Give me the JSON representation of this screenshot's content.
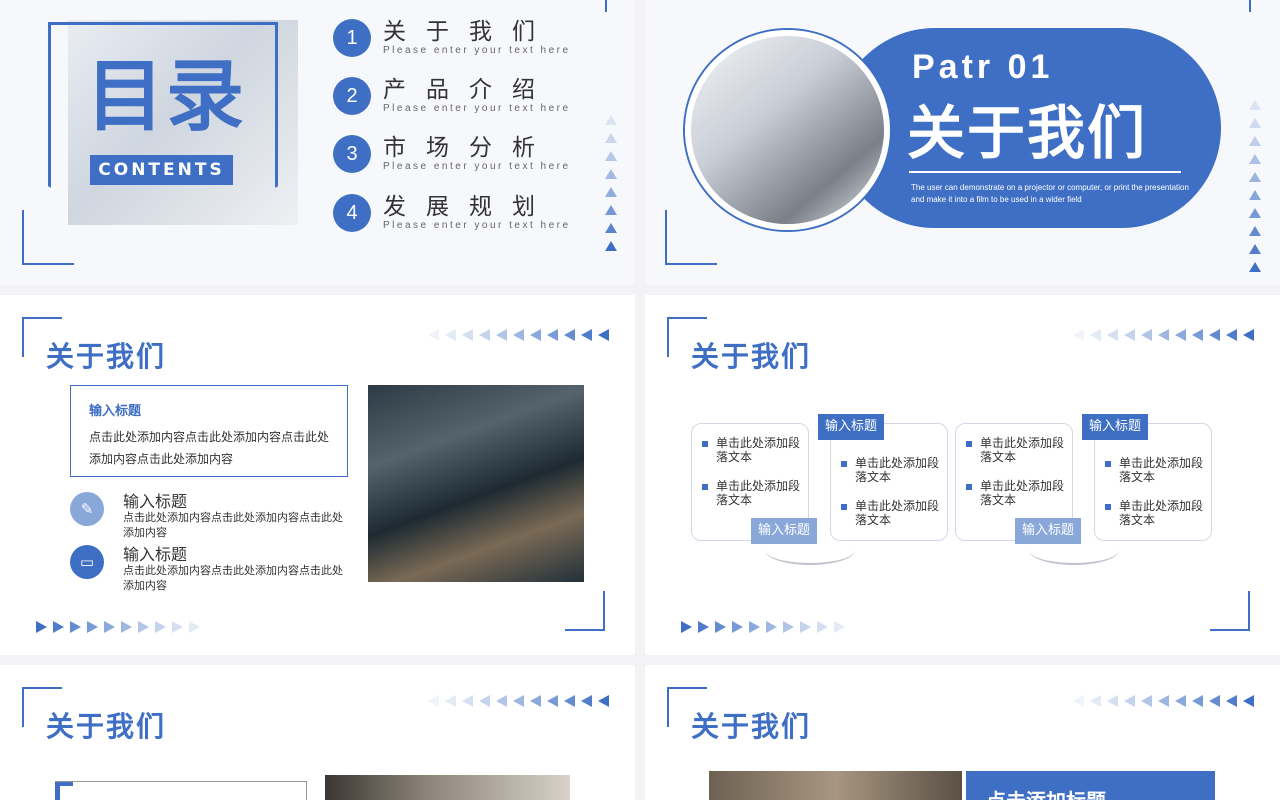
{
  "slide1": {
    "title": "目录",
    "subtitle": "CONTENTS",
    "items": [
      {
        "num": "1",
        "title": "关于我们",
        "sub": "Please enter your text here"
      },
      {
        "num": "2",
        "title": "产品介绍",
        "sub": "Please enter your text here"
      },
      {
        "num": "3",
        "title": "市场分析",
        "sub": "Please enter your text here"
      },
      {
        "num": "4",
        "title": "发展规划",
        "sub": "Please enter your text here"
      }
    ]
  },
  "slide2": {
    "part": "Patr 01",
    "title": "关于我们",
    "desc": "The user can demonstrate on a projector or computer, or print the presentation and make it into a film to be used in a wider field"
  },
  "slide3": {
    "title": "关于我们",
    "box_title": "输入标题",
    "box_body": "点击此处添加内容点击此处添加内容点击此处添加内容点击此处添加内容",
    "items": [
      {
        "title": "输入标题",
        "body": "点击此处添加内容点击此处添加内容点击此处添加内容"
      },
      {
        "title": "输入标题",
        "body": "点击此处添加内容点击此处添加内容点击此处添加内容"
      }
    ]
  },
  "slide4": {
    "title": "关于我们",
    "bullet_a": "单击此处添加段落文本",
    "bullet_b": "单击此处添加段落文本",
    "tag": "输入标题"
  },
  "slide5": {
    "title": "关于我们"
  },
  "slide6": {
    "title": "关于我们",
    "band": "点击添加标题"
  },
  "colors": {
    "accent": "#3e6fc4",
    "accent_light": "#8aa7da"
  }
}
